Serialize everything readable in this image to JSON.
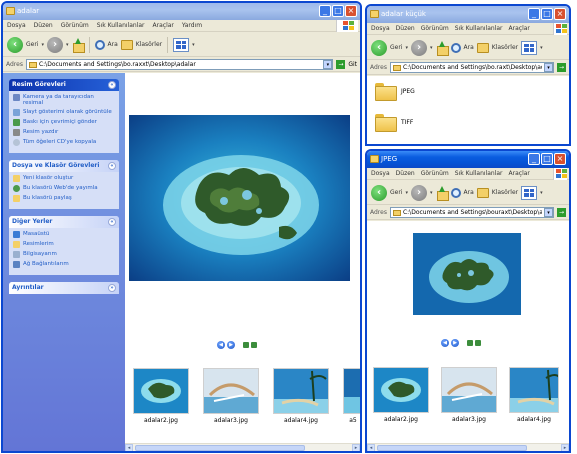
{
  "windows": {
    "main": {
      "title": "adalar",
      "menu": [
        "Dosya",
        "Düzen",
        "Görünüm",
        "Sık Kullanılanlar",
        "Araçlar",
        "Yardım"
      ],
      "toolbar": {
        "back": "Geri",
        "search": "Ara",
        "folders": "Klasörler"
      },
      "address": {
        "label": "Adres",
        "value": "C:\\Documents and Settings\\bo.raxxt\\Desktop\\adalar",
        "go": "Git"
      },
      "taskpane": [
        {
          "title": "Resim Görevleri",
          "items": [
            "Kamera ya da tarayıcıdan resimal",
            "Slayt gösterimi olarak görüntüle",
            "Baskı için çevrimiçi gönder",
            "Resim yazdır",
            "Tüm öğeleri CD'ye kopyala"
          ]
        },
        {
          "title": "Dosya ve Klasör Görevleri",
          "items": [
            "Yeni klasör oluştur",
            "Bu klasörü Web'de yayımla",
            "Bu klasörü paylaş"
          ]
        },
        {
          "title": "Diğer Yerler",
          "items": [
            "Masaüstü",
            "Resimlerim",
            "Bilgisayarım",
            "Ağ Bağlantılarım"
          ]
        },
        {
          "title": "Ayrıntılar",
          "items": []
        }
      ],
      "thumbnails": [
        "adalar2.jpg",
        "adalar3.jpg",
        "adalar4.jpg",
        "a5"
      ]
    },
    "small": {
      "title": "adalar küçük",
      "menu": [
        "Dosya",
        "Düzen",
        "Görünüm",
        "Sık Kullanılanlar",
        "Araçlar"
      ],
      "toolbar": {
        "back": "Geri",
        "search": "Ara",
        "folders": "Klasörler"
      },
      "address": {
        "label": "Adres",
        "value": "C:\\Documents and Settings\\bo.raxt\\Desktop\\adalar k",
        "go": ""
      },
      "folders": [
        "JPEG",
        "TIFF"
      ]
    },
    "jpeg": {
      "title": "JPEG",
      "menu": [
        "Dosya",
        "Düzen",
        "Görünüm",
        "Sık Kullanılanlar",
        "Araçlar"
      ],
      "toolbar": {
        "back": "Geri",
        "search": "Ara",
        "folders": "Klasörler"
      },
      "address": {
        "label": "Adres",
        "value": "C:\\Documents and Settings\\bouraxt\\Desktop\\adala",
        "go": ""
      },
      "thumbnails": [
        "adalar2.jpg",
        "adalar3.jpg",
        "adalar4.jpg"
      ]
    }
  },
  "colors": {
    "xp_blue": "#0b47d0",
    "task_link": "#215dc6",
    "sea": "#1b8fc9"
  }
}
